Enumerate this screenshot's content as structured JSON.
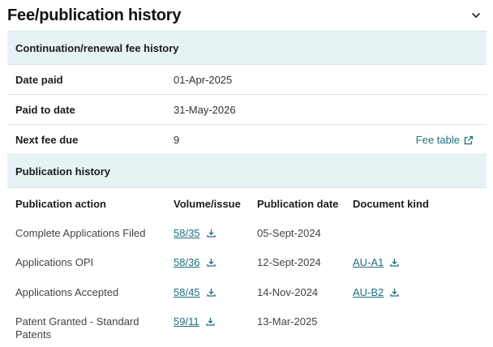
{
  "title": "Fee/publication history",
  "renewal": {
    "heading": "Continuation/renewal fee history",
    "rows": [
      {
        "label": "Date paid",
        "value": "01-Apr-2025"
      },
      {
        "label": "Paid to date",
        "value": "31-May-2026"
      },
      {
        "label": "Next fee due",
        "value": "9"
      }
    ],
    "fee_table_link": "Fee table"
  },
  "publication": {
    "heading": "Publication history",
    "columns": [
      "Publication action",
      "Volume/issue",
      "Publication date",
      "Document kind"
    ],
    "rows": [
      {
        "action": "Complete Applications Filed",
        "volume": "58/35",
        "date": "05-Sept-2024",
        "kind": ""
      },
      {
        "action": "Applications OPI",
        "volume": "58/36",
        "date": "12-Sept-2024",
        "kind": "AU-A1"
      },
      {
        "action": "Applications Accepted",
        "volume": "58/45",
        "date": "14-Nov-2024",
        "kind": "AU-B2"
      },
      {
        "action": "Patent Granted - Standard Patents",
        "volume": "59/11",
        "date": "13-Mar-2025",
        "kind": ""
      }
    ]
  },
  "icons": {
    "collapse": "chevron-down-icon",
    "external": "external-link-icon",
    "download": "download-icon"
  }
}
